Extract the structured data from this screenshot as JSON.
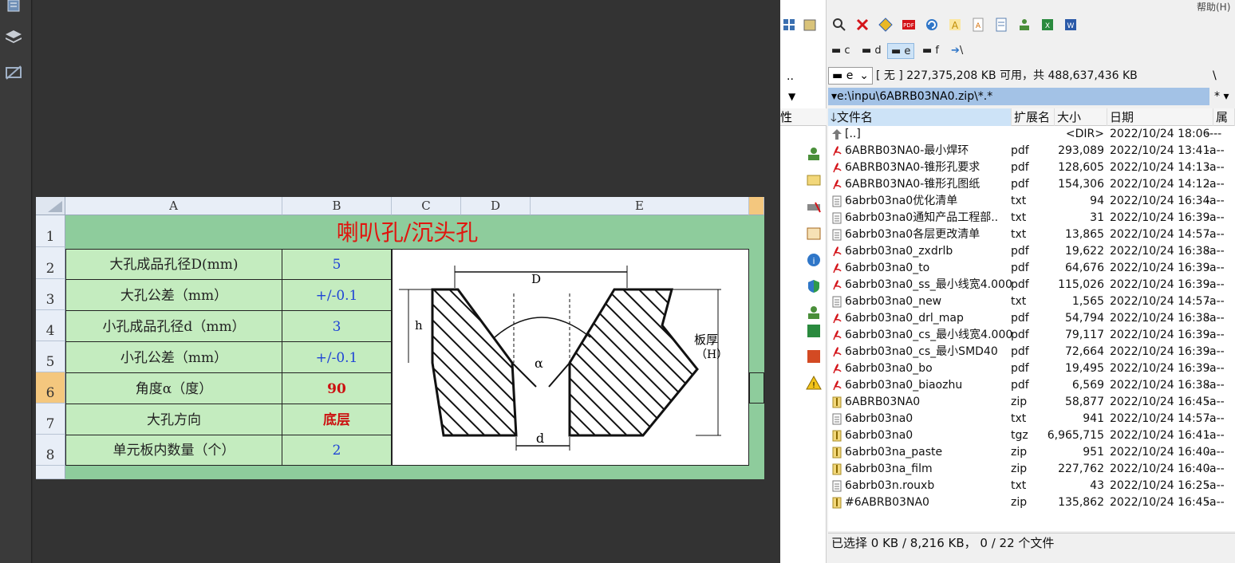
{
  "menu": {
    "help": "帮助(H)"
  },
  "sheet": {
    "columns": [
      "A",
      "B",
      "C",
      "D",
      "E"
    ],
    "rows": [
      "1",
      "2",
      "3",
      "4",
      "5",
      "6",
      "7",
      "8"
    ],
    "title": "喇叭孔/沉头孔",
    "items": [
      {
        "label": "大孔成品孔径D(mm)",
        "value": "5",
        "color": "blue"
      },
      {
        "label": "大孔公差（mm）",
        "value": "+/-0.1",
        "color": "blue"
      },
      {
        "label": "小孔成品孔径d（mm）",
        "value": "3",
        "color": "blue"
      },
      {
        "label": "小孔公差（mm）",
        "value": "+/-0.1",
        "color": "blue"
      },
      {
        "label": "角度α（度）",
        "value": "90",
        "color": "red"
      },
      {
        "label": "大孔方向",
        "value": "底层",
        "color": "red"
      },
      {
        "label": "单元板内数量（个）",
        "value": "2",
        "color": "blue"
      }
    ],
    "diagram": {
      "D": "D",
      "h": "h",
      "alpha": "α",
      "d": "d",
      "thickness": "板厚",
      "H": "（H）"
    }
  },
  "filemanager": {
    "drives": [
      {
        "icon": "drive-icon",
        "label": "c"
      },
      {
        "icon": "drive-icon",
        "label": "d"
      },
      {
        "icon": "drive-icon",
        "label": "e"
      },
      {
        "icon": "drive-icon",
        "label": "f"
      },
      {
        "icon": "network-icon",
        "label": "\\"
      }
    ],
    "drive_select": "e",
    "free_space": "[ 无 ]  227,375,208 KB 可用，共 488,637,436 KB",
    "root_btn": "\\",
    "up_btn": "..",
    "path": "e:\\inpu\\6ABRB03NA0.zip\\*.*",
    "filter": "*",
    "left_col_label": "性",
    "columns": {
      "name": "文件名",
      "ext": "扩展名",
      "size": "大小",
      "date": "日期",
      "attr": "属性"
    },
    "files": [
      {
        "type": "up",
        "name": "[..]",
        "ext": "",
        "size": "<DIR>",
        "date": "2022/10/24 18:06",
        "attr": "----"
      },
      {
        "type": "pdf",
        "name": "6ABRB03NA0-最小焊环",
        "ext": "pdf",
        "size": "293,089",
        "date": "2022/10/24 13:41",
        "attr": "-a--"
      },
      {
        "type": "pdf",
        "name": "6ABRB03NA0-锥形孔要求",
        "ext": "pdf",
        "size": "128,605",
        "date": "2022/10/24 14:13",
        "attr": "-a--"
      },
      {
        "type": "pdf",
        "name": "6ABRB03NA0-锥形孔图纸",
        "ext": "pdf",
        "size": "154,306",
        "date": "2022/10/24 14:12",
        "attr": "-a--"
      },
      {
        "type": "txt",
        "name": "6abrb03na0优化清单",
        "ext": "txt",
        "size": "94",
        "date": "2022/10/24 16:34",
        "attr": "-a--"
      },
      {
        "type": "txt",
        "name": "6abrb03na0通知产品工程部..",
        "ext": "txt",
        "size": "31",
        "date": "2022/10/24 16:39",
        "attr": "-a--"
      },
      {
        "type": "txt",
        "name": "6abrb03na0各层更改清单",
        "ext": "txt",
        "size": "13,865",
        "date": "2022/10/24 14:57",
        "attr": "-a--"
      },
      {
        "type": "pdf",
        "name": "6abrb03na0_zxdrlb",
        "ext": "pdf",
        "size": "19,622",
        "date": "2022/10/24 16:38",
        "attr": "-a--"
      },
      {
        "type": "pdf",
        "name": "6abrb03na0_to",
        "ext": "pdf",
        "size": "64,676",
        "date": "2022/10/24 16:39",
        "attr": "-a--"
      },
      {
        "type": "pdf",
        "name": "6abrb03na0_ss_最小线宽4.000",
        "ext": "pdf",
        "size": "115,026",
        "date": "2022/10/24 16:39",
        "attr": "-a--"
      },
      {
        "type": "txt",
        "name": "6abrb03na0_new",
        "ext": "txt",
        "size": "1,565",
        "date": "2022/10/24 14:57",
        "attr": "-a--"
      },
      {
        "type": "pdf",
        "name": "6abrb03na0_drl_map",
        "ext": "pdf",
        "size": "54,794",
        "date": "2022/10/24 16:38",
        "attr": "-a--"
      },
      {
        "type": "pdf",
        "name": "6abrb03na0_cs_最小线宽4.000",
        "ext": "pdf",
        "size": "79,117",
        "date": "2022/10/24 16:39",
        "attr": "-a--"
      },
      {
        "type": "pdf",
        "name": "6abrb03na0_cs_最小SMD40",
        "ext": "pdf",
        "size": "72,664",
        "date": "2022/10/24 16:39",
        "attr": "-a--"
      },
      {
        "type": "pdf",
        "name": "6abrb03na0_bo",
        "ext": "pdf",
        "size": "19,495",
        "date": "2022/10/24 16:39",
        "attr": "-a--"
      },
      {
        "type": "pdf",
        "name": "6abrb03na0_biaozhu",
        "ext": "pdf",
        "size": "6,569",
        "date": "2022/10/24 16:38",
        "attr": "-a--"
      },
      {
        "type": "zip",
        "name": "6ABRB03NA0",
        "ext": "zip",
        "size": "58,877",
        "date": "2022/10/24 16:45",
        "attr": "-a--"
      },
      {
        "type": "txt",
        "name": "6abrb03na0",
        "ext": "txt",
        "size": "941",
        "date": "2022/10/24 14:57",
        "attr": "-a--"
      },
      {
        "type": "zip",
        "name": "6abrb03na0",
        "ext": "tgz",
        "size": "6,965,715",
        "date": "2022/10/24 16:41",
        "attr": "-a--"
      },
      {
        "type": "zip",
        "name": "6abrb03na_paste",
        "ext": "zip",
        "size": "951",
        "date": "2022/10/24 16:40",
        "attr": "-a--"
      },
      {
        "type": "zip",
        "name": "6abrb03na_film",
        "ext": "zip",
        "size": "227,762",
        "date": "2022/10/24 16:40",
        "attr": "-a--"
      },
      {
        "type": "txt",
        "name": "6abrb03n.rouxb",
        "ext": "txt",
        "size": "43",
        "date": "2022/10/24 16:25",
        "attr": "-a--"
      },
      {
        "type": "zip",
        "name": "#6ABRB03NA0",
        "ext": "zip",
        "size": "135,862",
        "date": "2022/10/24 16:45",
        "attr": "-a--"
      }
    ],
    "status": "已选择 0 KB / 8,216 KB，  0 / 22 个文件"
  }
}
